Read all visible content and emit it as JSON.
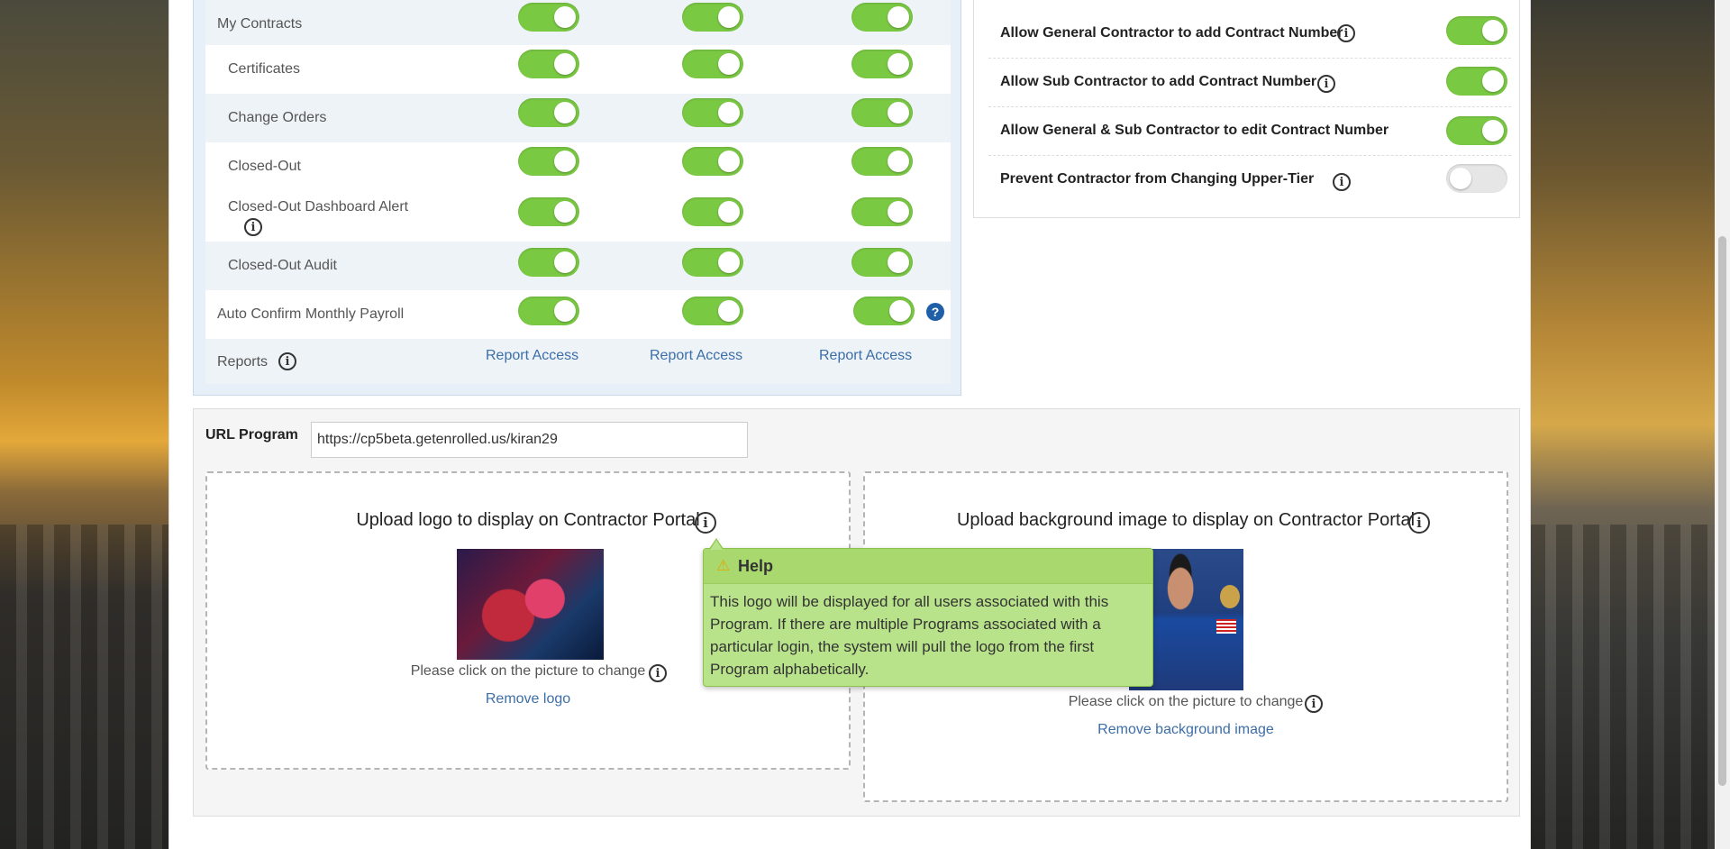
{
  "permissions": {
    "rows": [
      {
        "label": "My Contracts",
        "toggles": [
          "on",
          "on",
          "on"
        ]
      },
      {
        "label": "Certificates",
        "toggles": [
          "on",
          "on",
          "on"
        ]
      },
      {
        "label": "Change Orders",
        "toggles": [
          "on",
          "on",
          "on"
        ]
      },
      {
        "label": "Closed-Out",
        "toggles": [
          "on",
          "on",
          "on"
        ]
      },
      {
        "label": "Closed-Out Dashboard Alert",
        "toggles": [
          "on",
          "on",
          "on"
        ]
      },
      {
        "label": "Closed-Out Audit",
        "toggles": [
          "on",
          "on",
          "on"
        ]
      },
      {
        "label": "Auto Confirm Monthly Payroll",
        "toggles": [
          "on",
          "on",
          "on"
        ]
      }
    ],
    "reports_label": "Reports",
    "report_links": [
      "Report Access",
      "Report Access",
      "Report Access"
    ]
  },
  "settings": {
    "rows": [
      {
        "label": "Allow General Contractor to add Contract Number",
        "state": "on"
      },
      {
        "label": "Allow Sub Contractor to add Contract Number",
        "state": "on"
      },
      {
        "label": "Allow General & Sub Contractor to edit Contract Number",
        "state": "on"
      },
      {
        "label": "Prevent Contractor from Changing Upper-Tier",
        "state": "off"
      }
    ]
  },
  "url_program": {
    "label": "URL Program",
    "value": "https://cp5beta.getenrolled.us/kiran29"
  },
  "logo_upload": {
    "title": "Upload logo to display on Contractor Portal",
    "caption": "Please click on the picture to change",
    "remove_label": "Remove logo"
  },
  "background_upload": {
    "title": "Upload background image to display on Contractor Portal",
    "caption": "Please click on the picture to change",
    "remove_label": "Remove background image"
  },
  "tooltip": {
    "title": "Help",
    "body": "This logo will be displayed for all users associated with this Program. If there are multiple Programs associated with a particular login, the system will pull the logo from the first Program alphabetically."
  },
  "colors": {
    "toggle_on": "#7ac943",
    "toggle_off": "#e6e6e6",
    "link": "#3c6ea8",
    "tooltip_bg": "#b9e38a"
  }
}
